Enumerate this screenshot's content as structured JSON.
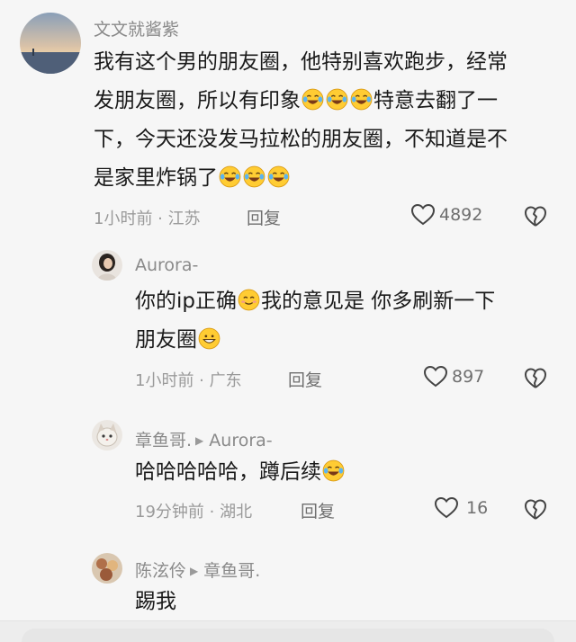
{
  "comments": [
    {
      "username": "文文就酱紫",
      "lines": [
        [
          "我有这个男的朋友圈，他特别喜欢跑步，经常"
        ],
        [
          "发朋友圈，所以有印象",
          "emoji:laugh-cry",
          "emoji:laugh-cry",
          "emoji:laugh-cry",
          "特意去翻了一"
        ],
        [
          "下，今天还没发马拉松的朋友圈，不知道是不"
        ],
        [
          "是家里炸锅了",
          "emoji:laugh-cry",
          "emoji:laugh-cry",
          "emoji:laugh-cry"
        ]
      ],
      "time_location": "1小时前 · 江苏",
      "reply_label": "回复",
      "likes": "4892"
    },
    {
      "username": "Aurora-",
      "lines": [
        [
          "你的ip正确",
          "emoji:smile-blush",
          "我的意见是 你多刷新一下"
        ],
        [
          "朋友圈",
          "emoji:grin"
        ]
      ],
      "time_location": "1小时前 · 广东",
      "reply_label": "回复",
      "likes": "897"
    },
    {
      "username": "章鱼哥.",
      "reply_to": "Aurora-",
      "lines": [
        [
          "哈哈哈哈哈，蹲后续",
          "emoji:laugh-cry"
        ]
      ],
      "time_location": "19分钟前 · 湖北",
      "reply_label": "回复",
      "likes": "16"
    },
    {
      "username": "陈泫伶",
      "reply_to": "章鱼哥.",
      "lines": [
        [
          "踢我"
        ]
      ]
    }
  ],
  "colors": {
    "background": "#f6f6f6",
    "text": "#1a1a1a",
    "meta": "#9a9a9a",
    "emoji_face": "#ffcc33"
  },
  "icons": [
    "heart-outline-icon",
    "broken-heart-icon",
    "reply-arrow-icon"
  ]
}
